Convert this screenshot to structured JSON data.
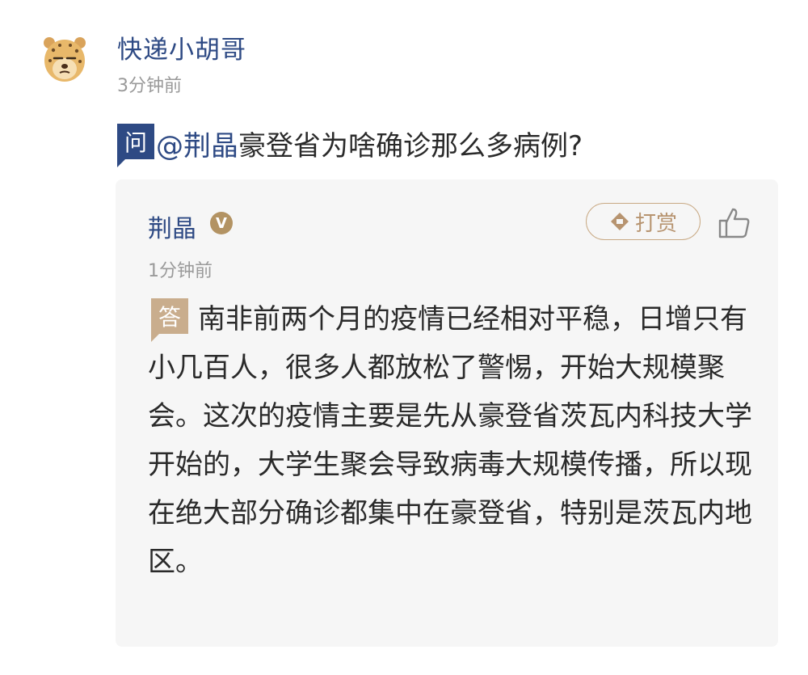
{
  "question": {
    "author": "快递小胡哥",
    "time": "3分钟前",
    "badge": "问",
    "mention": "@荆晶",
    "text": "豪登省为啥确诊那么多病例?"
  },
  "answer": {
    "author": "荆晶",
    "verified_badge": "V",
    "tip_label": "打赏",
    "time": "1分钟前",
    "badge": "答",
    "text": "南非前两个月的疫情已经相对平稳，日增只有小几百人，很多人都放松了警惕，开始大规模聚会。这次的疫情主要是先从豪登省茨瓦内科技大学开始的，大学生聚会导致病毒大规模传播，所以现在绝大部分确诊都集中在豪登省，特别是茨瓦内地区。"
  },
  "icons": {
    "avatar": "cheetah-avatar-icon",
    "verified": "verified-badge-icon",
    "tip": "diamond-tip-icon",
    "like": "thumbs-up-icon"
  },
  "colors": {
    "brand_blue": "#2e4a84",
    "answer_gold": "#c9ad8d",
    "timestamp_gray": "#9a9a9a",
    "card_background": "#f6f6f6"
  }
}
